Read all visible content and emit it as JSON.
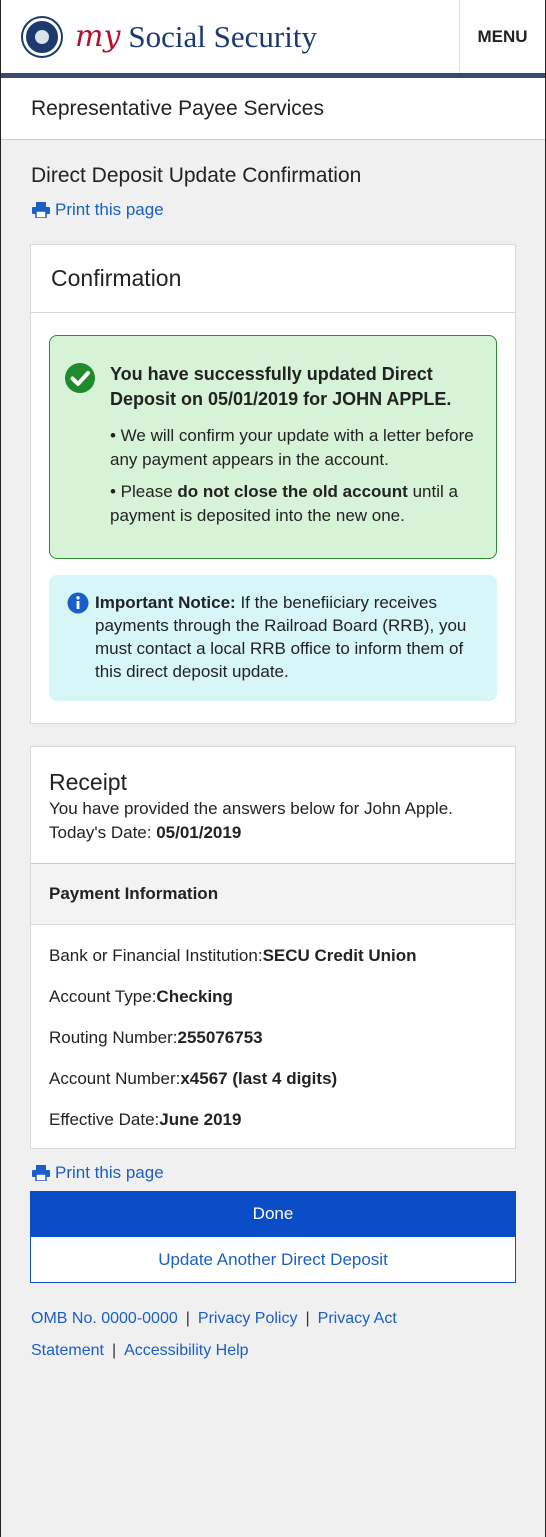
{
  "header": {
    "brand_my": "my",
    "brand_name": "Social Security",
    "menu_label": "MENU"
  },
  "subheader": {
    "title": "Representative Payee Services"
  },
  "page": {
    "title": "Direct Deposit Update Confirmation",
    "print_label": "Print this page"
  },
  "confirmation": {
    "heading": "Confirmation",
    "success_title": "You have successfully updated Direct Deposit on 05/01/2019 for JOHN APPLE.",
    "bullet1": "• We will confirm your update with a letter before any payment appears in the account.",
    "bullet2_pre": "• Please ",
    "bullet2_bold": "do not close the old account",
    "bullet2_post": " until a payment is deposited into the new one.",
    "notice_label": "Important Notice:",
    "notice_text": " If the benefiiciary receives payments through the Railroad Board (RRB), you must contact a local RRB office to inform them of this direct deposit update."
  },
  "receipt": {
    "heading": "Receipt",
    "intro": "You have provided the answers below for John Apple.",
    "date_label": "Today's Date: ",
    "date_value": "05/01/2019",
    "payment_heading": "Payment Information",
    "rows": [
      {
        "label": "Bank or Financial Institution: ",
        "value": "SECU Credit Union"
      },
      {
        "label": "Account Type: ",
        "value": "Checking"
      },
      {
        "label": "Routing Number: ",
        "value": "255076753"
      },
      {
        "label": "Account Number: ",
        "value": "x4567 (last 4 digits)"
      },
      {
        "label": "Effective Date: ",
        "value": "June 2019"
      }
    ]
  },
  "actions": {
    "done": "Done",
    "update_another": "Update Another Direct Deposit"
  },
  "footer": {
    "omb": "OMB No. 0000-0000",
    "privacy_policy": "Privacy Policy",
    "privacy_act": "Privacy Act",
    "statement": "Statement",
    "accessibility": "Accessibility Help",
    "sep": "|"
  },
  "colors": {
    "brand_red": "#b3122e",
    "brand_navy": "#1c3a6e",
    "link": "#1a5fc8",
    "primary": "#0b4cc7",
    "success_bg": "#d7f3d7",
    "notice_bg": "#d6f6f8"
  },
  "icons": {
    "print": "printer-icon",
    "check": "check-circle-icon",
    "info": "info-circle-icon",
    "seal": "ssa-seal-logo"
  }
}
